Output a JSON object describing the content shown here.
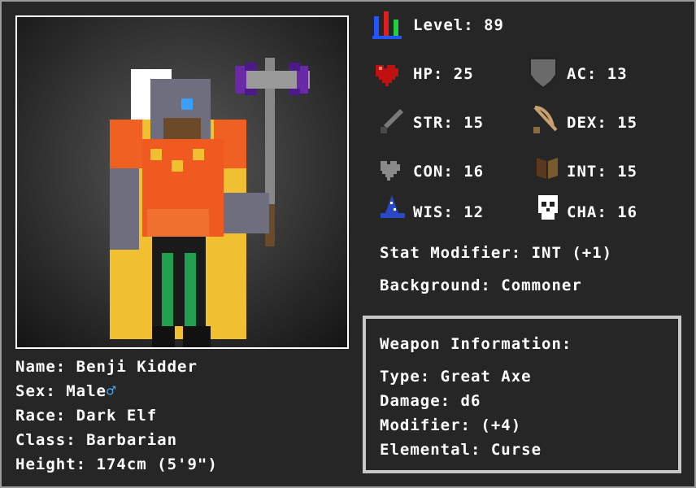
{
  "character": {
    "level_label": "Level: 89",
    "name_label": "Name: Benji Kidder",
    "sex_label": "Sex: Male",
    "sex_symbol": "♂",
    "race_label": "Race: Dark Elf",
    "class_label": "Class: Barbarian",
    "height_label": "Height: 174cm (5'9\")"
  },
  "stats": {
    "hp": "HP: 25",
    "ac": "AC: 13",
    "str": "STR: 15",
    "dex": "DEX: 15",
    "con": "CON: 16",
    "int": "INT: 15",
    "wis": "WIS: 12",
    "cha": "CHA: 16",
    "stat_modifier": "Stat Modifier: INT (+1)",
    "background": "Background: Commoner"
  },
  "weapon": {
    "header": "Weapon Information:",
    "type": "Type: Great Axe",
    "damage": "Damage: d6",
    "modifier": "Modifier: (+4)",
    "elemental": "Elemental: Curse"
  },
  "icons": {
    "level": "bar-chart-icon",
    "hp": "heart-icon",
    "ac": "shield-icon",
    "str": "sword-icon",
    "dex": "bow-icon",
    "con": "grey-heart-icon",
    "int": "book-icon",
    "wis": "wizard-hat-icon",
    "cha": "skull-icon"
  },
  "colors": {
    "background": "#262626",
    "text": "#ffffff",
    "frame": "#9a9a9a",
    "male_symbol": "#4aa8ff"
  }
}
